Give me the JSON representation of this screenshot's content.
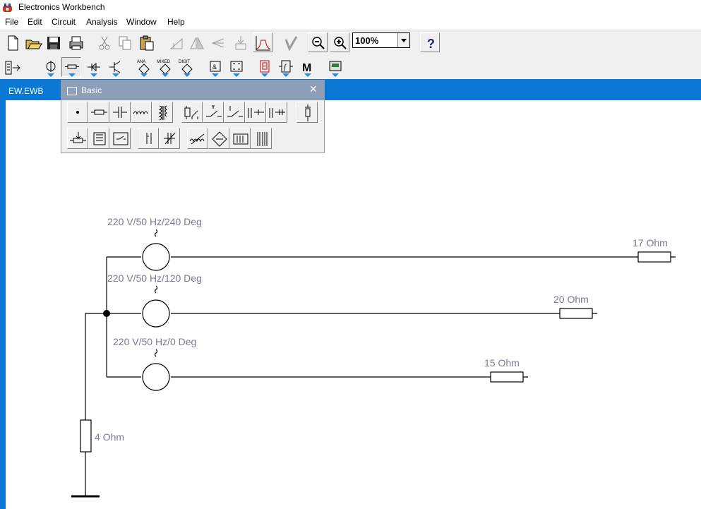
{
  "window": {
    "title": "Electronics Workbench"
  },
  "menu": [
    "File",
    "Edit",
    "Circuit",
    "Analysis",
    "Window",
    "Help"
  ],
  "toolbar": {
    "zoom": "100%",
    "buttons": [
      "new-file",
      "open-folder",
      "save",
      "print",
      "cut",
      "copy",
      "paste",
      "rotate",
      "flip-horizontal",
      "flip-vertical",
      "subcircuit",
      "graph",
      "component-properties",
      "zoom-out",
      "zoom-in",
      "help"
    ]
  },
  "parts_bin": {
    "bins": [
      "favorites",
      "sources",
      "basic",
      "diodes",
      "transistors",
      "analog-ics",
      "mixed-ics",
      "digital-ics",
      "logic-gates",
      "digital",
      "indicators",
      "controls",
      "miscellaneous",
      "instruments"
    ],
    "bin_labels": {
      "analog": "ANA",
      "mixed": "MIXED",
      "digital": "DIGIT"
    }
  },
  "document": {
    "tab": "EW.EWB"
  },
  "palette": {
    "title": "Basic",
    "row1": [
      "connector",
      "resistor",
      "capacitor",
      "inductor",
      "transformer",
      "relay",
      "switch",
      "time-delay-switch",
      "voltage-controlled-switch",
      "current-controlled-switch",
      "pull-up-resistor"
    ],
    "row2": [
      "potentiometer",
      "resistor-pack",
      "voltage-controlled-analog-switch",
      "polarized-capacitor",
      "variable-capacitor",
      "variable-inductor",
      "coreless-coil",
      "magnetic-core",
      "nonlinear-transformer"
    ]
  },
  "circuit": {
    "sources": [
      {
        "label": "220 V/50 Hz/240 Deg"
      },
      {
        "label": "220 V/50 Hz/120 Deg"
      },
      {
        "label": "220 V/50 Hz/0 Deg"
      }
    ],
    "loads": [
      {
        "label": "17  Ohm"
      },
      {
        "label": "20  Ohm"
      },
      {
        "label": "15  Ohm"
      }
    ],
    "neutral_resistor": {
      "label": "4  Ohm"
    }
  },
  "colors": {
    "accent": "#0a78d4",
    "palette_title": "#8d9fb9",
    "label": "#7a7a9a"
  }
}
